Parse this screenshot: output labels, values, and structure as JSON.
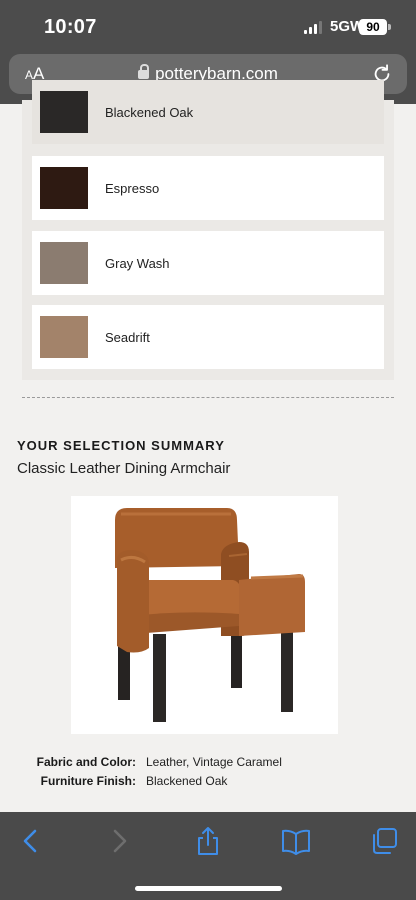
{
  "status_bar": {
    "time": "10:07",
    "network": "5GW",
    "battery": "90"
  },
  "browser": {
    "text_size_small": "A",
    "text_size_large": "A",
    "url": "potterybarn.com"
  },
  "finish_options": [
    {
      "label": "Blackened Oak",
      "swatch_color": "#2a2827",
      "selected": true
    },
    {
      "label": "Espresso",
      "swatch_color": "#2e1a12",
      "selected": false
    },
    {
      "label": "Gray Wash",
      "swatch_color": "#8b7c70",
      "selected": false
    },
    {
      "label": "Seadrift",
      "swatch_color": "#a3836a",
      "selected": false
    }
  ],
  "summary": {
    "heading": "YOUR SELECTION SUMMARY",
    "product_name": "Classic Leather Dining Armchair",
    "details": [
      {
        "label": "Fabric and Color:",
        "value": "Leather, Vintage Caramel"
      },
      {
        "label": "Furniture Finish:",
        "value": "Blackened Oak"
      }
    ]
  },
  "colors": {
    "chrome": "#4c4c4c",
    "safari_blue": "#3f8de8",
    "leather": "#a4602f"
  },
  "toolbar": {
    "icons": [
      "back-icon",
      "forward-icon",
      "share-icon",
      "bookmarks-icon",
      "tabs-icon"
    ]
  }
}
